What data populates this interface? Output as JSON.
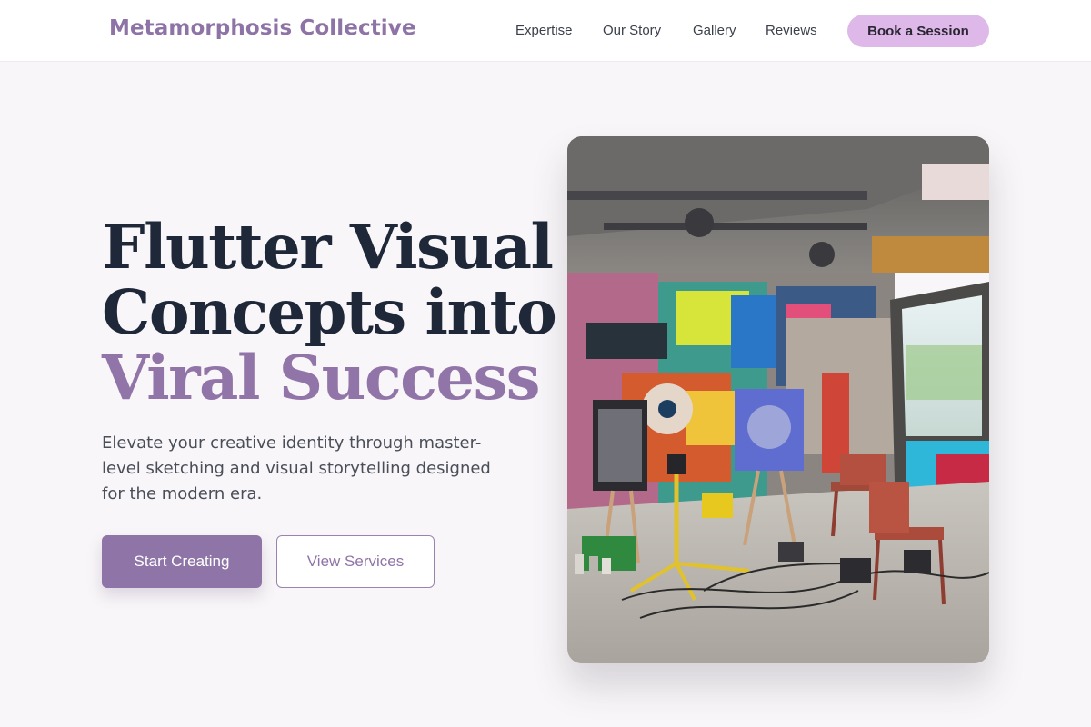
{
  "header": {
    "brand": "Metamorphosis Collective",
    "nav_links": [
      "Expertise",
      "Our Story",
      "Gallery",
      "Reviews"
    ],
    "cta_label": "Book a Session"
  },
  "hero": {
    "title_line1": "Flutter Visual",
    "title_line2": "Concepts into",
    "title_accent": "Viral Success",
    "subtitle": "Elevate your creative identity through master-level sketching and visual storytelling designed for the modern era.",
    "primary_button": "Start Creating",
    "secondary_button": "View Services"
  },
  "image": {
    "subject": "graffiti art studio with easels, canvases, chairs and tripod"
  },
  "colors": {
    "accent": "#8f74a7",
    "cta_bg": "#ddb8e8",
    "heading": "#1f2838",
    "page_bg": "#f8f6f8"
  }
}
